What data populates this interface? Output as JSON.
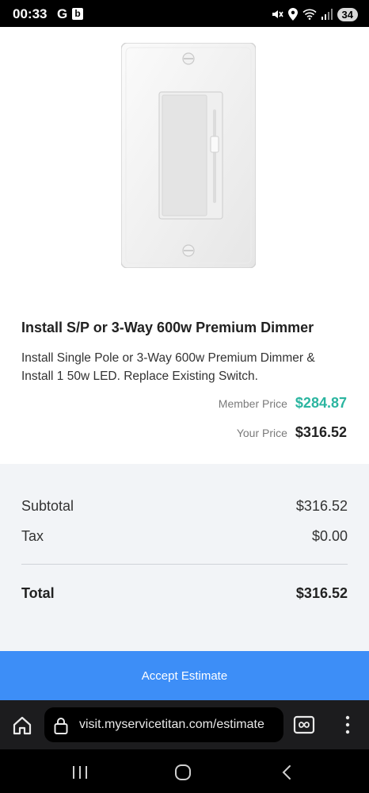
{
  "status_bar": {
    "time": "00:33",
    "g_label": "G",
    "b_label": "b",
    "battery": "34"
  },
  "item": {
    "title": "Install S/P or 3-Way 600w Premium Dimmer",
    "description": "Install Single Pole or 3-Way 600w Premium Dimmer & Install 1 50w LED. Replace Existing Switch.",
    "member_price_label": "Member Price",
    "member_price": "$284.87",
    "your_price_label": "Your Price",
    "your_price": "$316.52"
  },
  "summary": {
    "subtotal_label": "Subtotal",
    "subtotal_value": "$316.52",
    "tax_label": "Tax",
    "tax_value": "$0.00",
    "total_label": "Total",
    "total_value": "$316.52"
  },
  "actions": {
    "accept_label": "Accept Estimate"
  },
  "browser": {
    "url": "visit.myservicetitan.com/estimate"
  },
  "colors": {
    "accent": "#3d8ef7",
    "member_price": "#2bb5a0",
    "summary_bg": "#f2f4f7"
  }
}
